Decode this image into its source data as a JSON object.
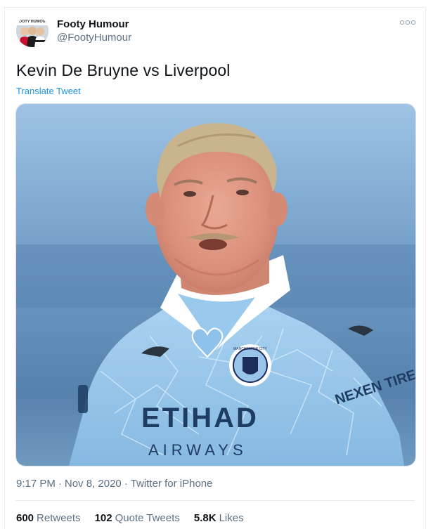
{
  "tweet": {
    "author_name": "Footy Humour",
    "author_handle": "@FootyHumour",
    "text": "Kevin De Bruyne vs Liverpool",
    "translate_label": "Translate Tweet",
    "time": "9:17 PM",
    "date": "Nov 8, 2020",
    "source": "Twitter for iPhone",
    "separator": "·",
    "avatar_caption": "FOOTY HUMOUR",
    "image_text": {
      "sponsor_main": "ETIHAD",
      "sponsor_sub": "AIRWAYS",
      "sleeve": "NEXEN TIRE",
      "crest": "MANCHESTER CITY"
    }
  },
  "stats": {
    "retweets_count": "600",
    "retweets_label": "Retweets",
    "quotes_count": "102",
    "quotes_label": "Quote Tweets",
    "likes_count": "5.8K",
    "likes_label": "Likes"
  },
  "colors": {
    "link": "#1b95e0",
    "secondary_text": "#5b7083",
    "primary_text": "#0f1419",
    "kit_blue": "#98c5e9"
  },
  "icons": {
    "more": "more-options-icon"
  }
}
